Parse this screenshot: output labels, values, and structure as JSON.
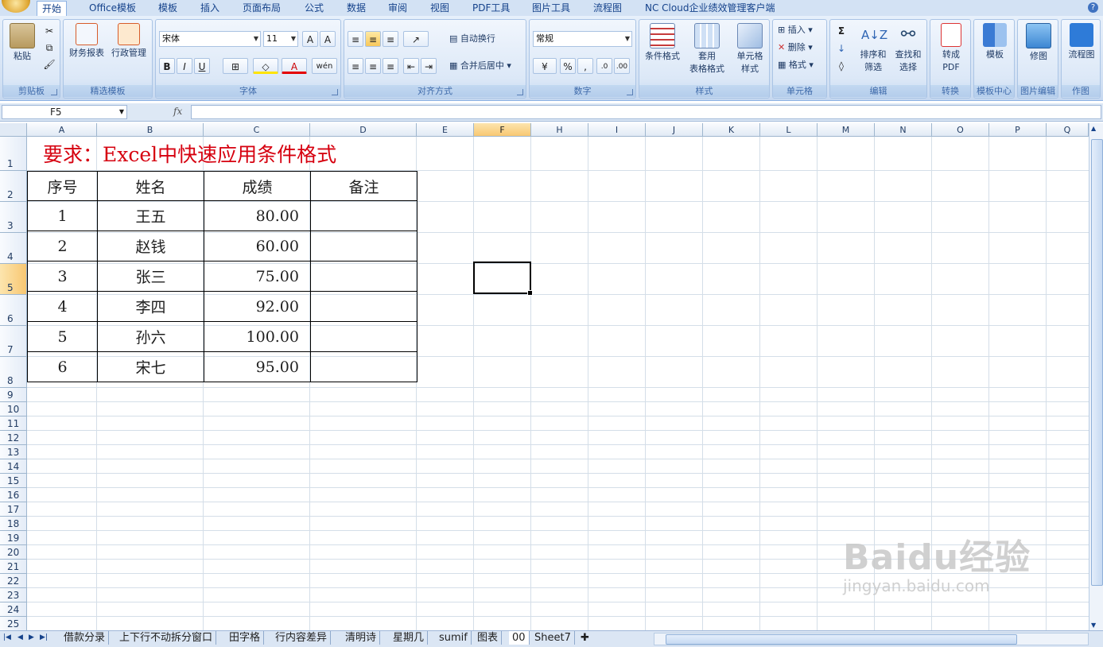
{
  "ribbon_tabs": [
    "开始",
    "Office模板",
    "模板",
    "插入",
    "页面布局",
    "公式",
    "数据",
    "审阅",
    "视图",
    "PDF工具",
    "图片工具",
    "流程图",
    "NC Cloud企业绩效管理客户端"
  ],
  "clipboard": {
    "paste": "粘贴",
    "label": "剪贴板"
  },
  "templates": {
    "finance": "财务报表",
    "admin": "行政管理",
    "label": "精选模板"
  },
  "font": {
    "name": "宋体",
    "size": "11",
    "label": "字体"
  },
  "align": {
    "wrap": "自动换行",
    "merge": "合并后居中",
    "label": "对齐方式"
  },
  "number": {
    "format": "常规",
    "label": "数字"
  },
  "styles": {
    "cond": "条件格式",
    "table1": "套用",
    "table2": "表格格式",
    "cell1": "单元格",
    "cell2": "样式",
    "label": "样式"
  },
  "cells": {
    "insert": "插入",
    "delete": "删除",
    "format": "格式",
    "label": "单元格"
  },
  "editing": {
    "sort1": "排序和",
    "sort2": "筛选",
    "find1": "查找和",
    "find2": "选择",
    "label": "编辑"
  },
  "convert": {
    "pdf1": "转成",
    "pdf2": "PDF",
    "label": "转换"
  },
  "tplcenter": {
    "btn": "模板",
    "label": "模板中心"
  },
  "imgedit": {
    "btn": "修图",
    "label": "图片编辑"
  },
  "draw": {
    "btn": "流程图",
    "label": "作图"
  },
  "formula_bar": {
    "name_box": "F5",
    "fx": "fx",
    "content": ""
  },
  "columns": [
    "A",
    "B",
    "C",
    "D",
    "E",
    "F",
    "H",
    "I",
    "J",
    "K",
    "L",
    "M",
    "N",
    "O",
    "P",
    "Q"
  ],
  "rows": [
    "1",
    "2",
    "3",
    "4",
    "5",
    "6",
    "7",
    "8",
    "9",
    "10",
    "11",
    "12",
    "13",
    "14",
    "15",
    "16",
    "17",
    "18",
    "19",
    "20",
    "21",
    "22",
    "23",
    "24",
    "25"
  ],
  "sheet": {
    "title": "要求：Excel中快速应用条件格式",
    "headers": [
      "序号",
      "姓名",
      "成绩",
      "备注"
    ],
    "records": [
      {
        "no": "1",
        "name": "王五",
        "score": "80.00",
        "note": ""
      },
      {
        "no": "2",
        "name": "赵钱",
        "score": "60.00",
        "note": ""
      },
      {
        "no": "3",
        "name": "张三",
        "score": "75.00",
        "note": ""
      },
      {
        "no": "4",
        "name": "李四",
        "score": "92.00",
        "note": ""
      },
      {
        "no": "5",
        "name": "孙六",
        "score": "100.00",
        "note": ""
      },
      {
        "no": "6",
        "name": "宋七",
        "score": "95.00",
        "note": ""
      }
    ]
  },
  "sheet_tabs": [
    "借款分录",
    "上下行不动拆分窗口",
    "田字格",
    "行内容差异",
    "清明诗",
    "星期几",
    "sumif",
    "图表",
    "00",
    "Sheet7"
  ],
  "active_sheet": "00",
  "watermark": {
    "line1": "Baidu经验",
    "line2": "jingyan.baidu.com"
  }
}
